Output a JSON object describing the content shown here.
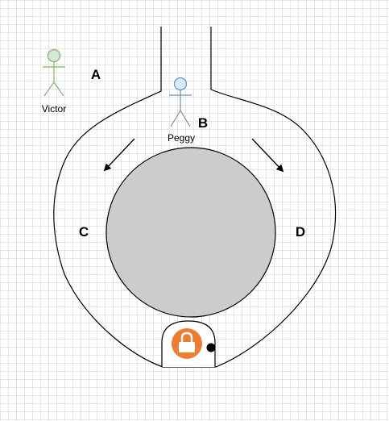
{
  "labels": {
    "a": "A",
    "b": "B",
    "c": "C",
    "d": "D"
  },
  "people": {
    "victor": {
      "name": "Victor",
      "icon": "stick-figure-icon",
      "color": "#82b366",
      "fill": "#d5e8d4"
    },
    "peggy": {
      "name": "Peggy",
      "icon": "stick-figure-icon",
      "color": "#6c8ebf",
      "fill": "#dae8fc"
    }
  },
  "cave": {
    "rock_color": "#cccccc",
    "outline_color": "#000000"
  },
  "door": {
    "lock_icon": "padlock-icon",
    "lock_color": "#ed7d31",
    "knob_color": "#000000"
  },
  "arrows": {
    "left": "arrow-down-left-icon",
    "right": "arrow-down-right-icon"
  },
  "colors": {
    "grid": "#e6e6e6",
    "background": "#ffffff"
  }
}
